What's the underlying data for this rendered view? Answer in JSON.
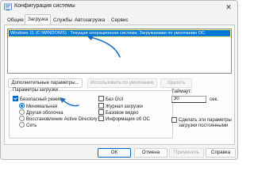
{
  "window": {
    "title": "Конфигурация системы",
    "app_icon": "msconfig-icon",
    "close_symbol": "✕"
  },
  "tabs": [
    {
      "label": "Общие",
      "active": false
    },
    {
      "label": "Загрузка",
      "active": true
    },
    {
      "label": "Службы",
      "active": false
    },
    {
      "label": "Автозагрузка",
      "active": false
    },
    {
      "label": "Сервис",
      "active": false
    }
  ],
  "os_list": {
    "items": [
      {
        "text": "Windows 11 (C:\\WINDOWS) : Текущая операционная система; Загружаемая по умолчанию ОС",
        "selected": true
      }
    ]
  },
  "list_buttons": {
    "advanced": "Дополнительные параметры...",
    "set_default": "Использовать по умолчанию",
    "delete": "Удалить"
  },
  "boot_options": {
    "legend": "Параметры загрузки",
    "safe_boot": {
      "label": "Безопасный режим",
      "checked": true
    },
    "minimal": {
      "label": "Минимальная",
      "selected": true
    },
    "alternate_shell": {
      "label": "Другая оболочка",
      "selected": false
    },
    "ad_repair": {
      "label": "Восстановление Active Directory",
      "selected": false
    },
    "network": {
      "label": "Сеть",
      "selected": false
    },
    "no_gui": {
      "label": "Без GUI",
      "checked": false
    },
    "boot_log": {
      "label": "Журнал загрузки",
      "checked": false
    },
    "base_video": {
      "label": "Базовое видео",
      "checked": false
    },
    "os_info": {
      "label": "Информация об ОС",
      "checked": false
    }
  },
  "timeout": {
    "label": "Таймаут:",
    "value": "30",
    "unit": "сек."
  },
  "make_permanent": {
    "line1": "Сделать эти параметры",
    "line2": "загрузки постоянными",
    "checked": false
  },
  "footer": {
    "ok": "ОК",
    "cancel": "Отмена",
    "apply": "Применить",
    "help": "Справка"
  },
  "colors": {
    "selection": "#0078d7",
    "accent": "#0067c0",
    "annotation_arrow": "#1f6fc4"
  }
}
